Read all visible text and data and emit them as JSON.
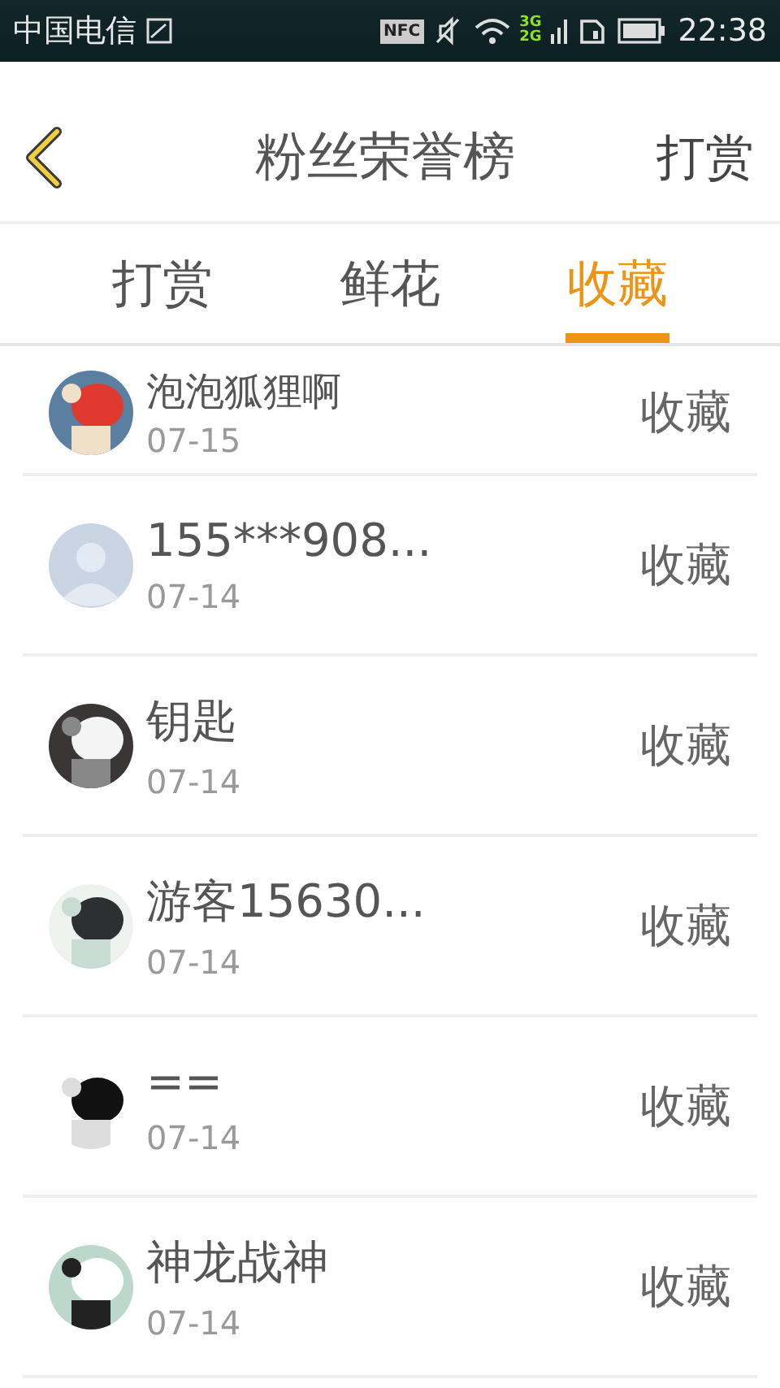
{
  "status_bar": {
    "carrier": "中国电信",
    "nfc": "NFC",
    "network_top": "3G",
    "network_bottom": "2G",
    "time": "22:38"
  },
  "header": {
    "title": "粉丝荣誉榜",
    "action": "打赏"
  },
  "tabs": [
    {
      "label": "打赏",
      "selected": false
    },
    {
      "label": "鲜花",
      "selected": false
    },
    {
      "label": "收藏",
      "selected": true
    }
  ],
  "rows": [
    {
      "name": "泡泡狐狸啊",
      "date": "07-15",
      "action": "收藏",
      "kind": "picture"
    },
    {
      "name": "155***908...",
      "date": "07-14",
      "action": "收藏",
      "kind": "default"
    },
    {
      "name": "钥匙",
      "date": "07-14",
      "action": "收藏",
      "kind": "picture"
    },
    {
      "name": "游客15630...",
      "date": "07-14",
      "action": "收藏",
      "kind": "picture"
    },
    {
      "name": "==",
      "date": "07-14",
      "action": "收藏",
      "kind": "picture"
    },
    {
      "name": "神龙战神",
      "date": "07-14",
      "action": "收藏",
      "kind": "picture"
    }
  ]
}
